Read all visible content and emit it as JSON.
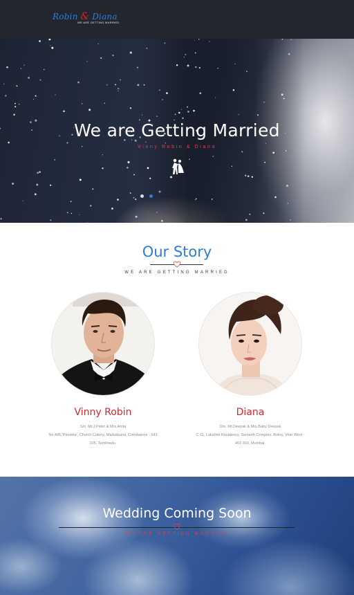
{
  "header": {
    "logo_names": "Robin & Diana",
    "logo_tagline": "WE ARE GETTING MARRIED"
  },
  "hero": {
    "title": "We are Getting Married",
    "subtitle": "Vinny Robin & Diana",
    "icon": "couple-dancing-icon",
    "slides_count": 2,
    "active_slide": 2
  },
  "story": {
    "title": "Our Story",
    "subtitle": "WE ARE GETTING MARRIED",
    "groom": {
      "name": "Vinny Robin",
      "parents": "S/o. Mr.J.Peter & Mrs.Anita",
      "address_line1": "No.495,'Pelumia', Church Colony, Madukkarai, Coimbatore - 641",
      "address_line2": "105, Tamilnadu."
    },
    "bride": {
      "name": "Diana",
      "parents": "D/o. Mr.Deepak & Mrs.Baby Deepak",
      "address_line1": "C-11, Lakshmi Residency, Samarth Complex, Bolinj, Virar West -",
      "address_line2": "401 303, Mumbai."
    }
  },
  "wedding": {
    "title": "Wedding Coming Soon",
    "subtitle": "WE ARE GETTING MARRIED"
  },
  "colors": {
    "accent_blue": "#2f7fd0",
    "accent_red": "#d2282e",
    "header_bg": "#23262e"
  }
}
